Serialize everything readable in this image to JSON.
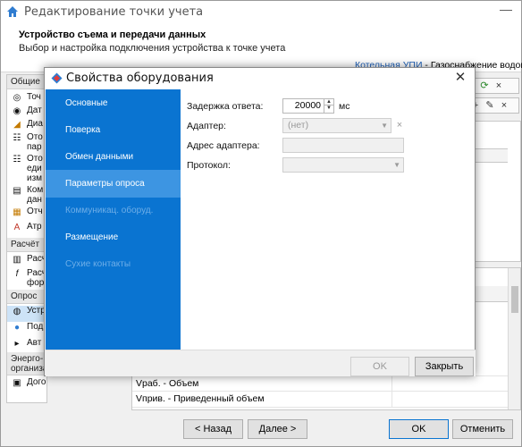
{
  "window": {
    "title": "Редактирование точки учета",
    "header_title": "Устройство съема и передачи данных",
    "header_subtitle": "Выбор и настройка подключения устройства к точке учета",
    "breadcrumb_link": "Котельная УПИ",
    "breadcrumb_rest": " - Газоснабжение водогрейн"
  },
  "tree": {
    "groups": [
      "Общие",
      "Расчёт",
      "Опрос",
      "Энерго-\nорганизация"
    ],
    "general_items": [
      "Точ",
      "Дат",
      "Диа",
      "Ото\nпар",
      "Ото\nеди\nизм",
      "Ком\nдан",
      "Отч",
      "Атр"
    ],
    "calc_items": [
      "Расч",
      "Расч\nфор"
    ],
    "poll_items": [
      "Устр",
      "Под",
      "Авт"
    ],
    "org_items": [
      "Договор"
    ]
  },
  "grid_rows": [
    "Vраб. - Объем",
    "Vприв. - Приведенный объем"
  ],
  "footer": {
    "back": "< Назад",
    "next": "Далее >",
    "ok": "OK",
    "cancel": "Отменить"
  },
  "dialog": {
    "title": "Свойства оборудования",
    "nav": [
      {
        "label": "Основные",
        "state": "normal"
      },
      {
        "label": "Поверка",
        "state": "normal"
      },
      {
        "label": "Обмен данными",
        "state": "normal"
      },
      {
        "label": "Параметры опроса",
        "state": "active"
      },
      {
        "label": "Коммуникац. оборуд.",
        "state": "disabled"
      },
      {
        "label": "Размещение",
        "state": "normal"
      },
      {
        "label": "Сухие контакты",
        "state": "disabled"
      }
    ],
    "fields": {
      "delay_label": "Задержка ответа:",
      "delay_value": "20000",
      "delay_unit": "мс",
      "adapter_label": "Адаптер:",
      "adapter_value": "(нет)",
      "adapter_address_label": "Адрес адаптера:",
      "adapter_address_value": "",
      "protocol_label": "Протокол:",
      "protocol_value": ""
    },
    "ok": "OK",
    "close": "Закрыть"
  },
  "colors": {
    "nav_bg": "#0a74d1",
    "nav_active": "#3d95e2",
    "link": "#1c5fb8"
  }
}
